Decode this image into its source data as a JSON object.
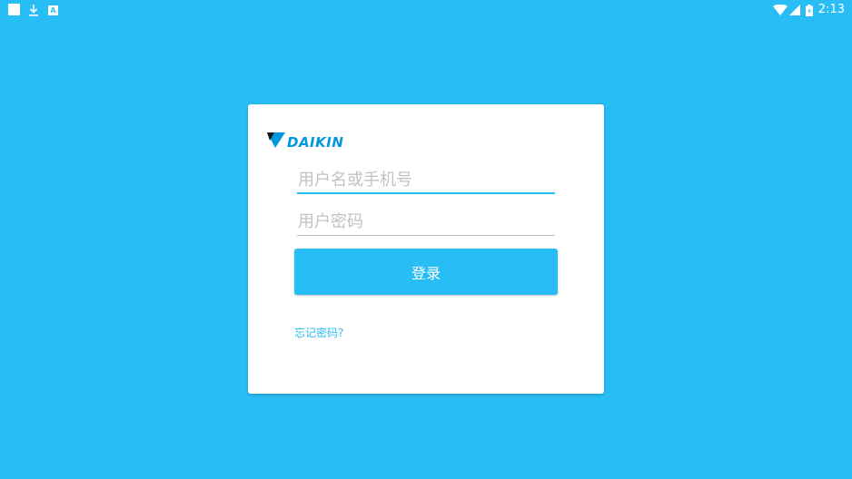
{
  "status_bar": {
    "notification_icons": [
      "square-notification-icon",
      "download-icon",
      "app-a-icon"
    ],
    "app_icon_letter": "A",
    "time": "2:13",
    "system_icons": [
      "wifi-icon",
      "signal-icon",
      "battery-icon"
    ]
  },
  "login": {
    "brand": "DAIKIN",
    "username_placeholder": "用户名或手机号",
    "username_value": "",
    "password_placeholder": "用户密码",
    "password_value": "",
    "login_button_label": "登录",
    "forgot_password_link": "忘记密码?"
  },
  "colors": {
    "background": "#29BDF5",
    "accent": "#29BDF5",
    "brand_blue": "#0097E0",
    "card": "#FFFFFF"
  }
}
